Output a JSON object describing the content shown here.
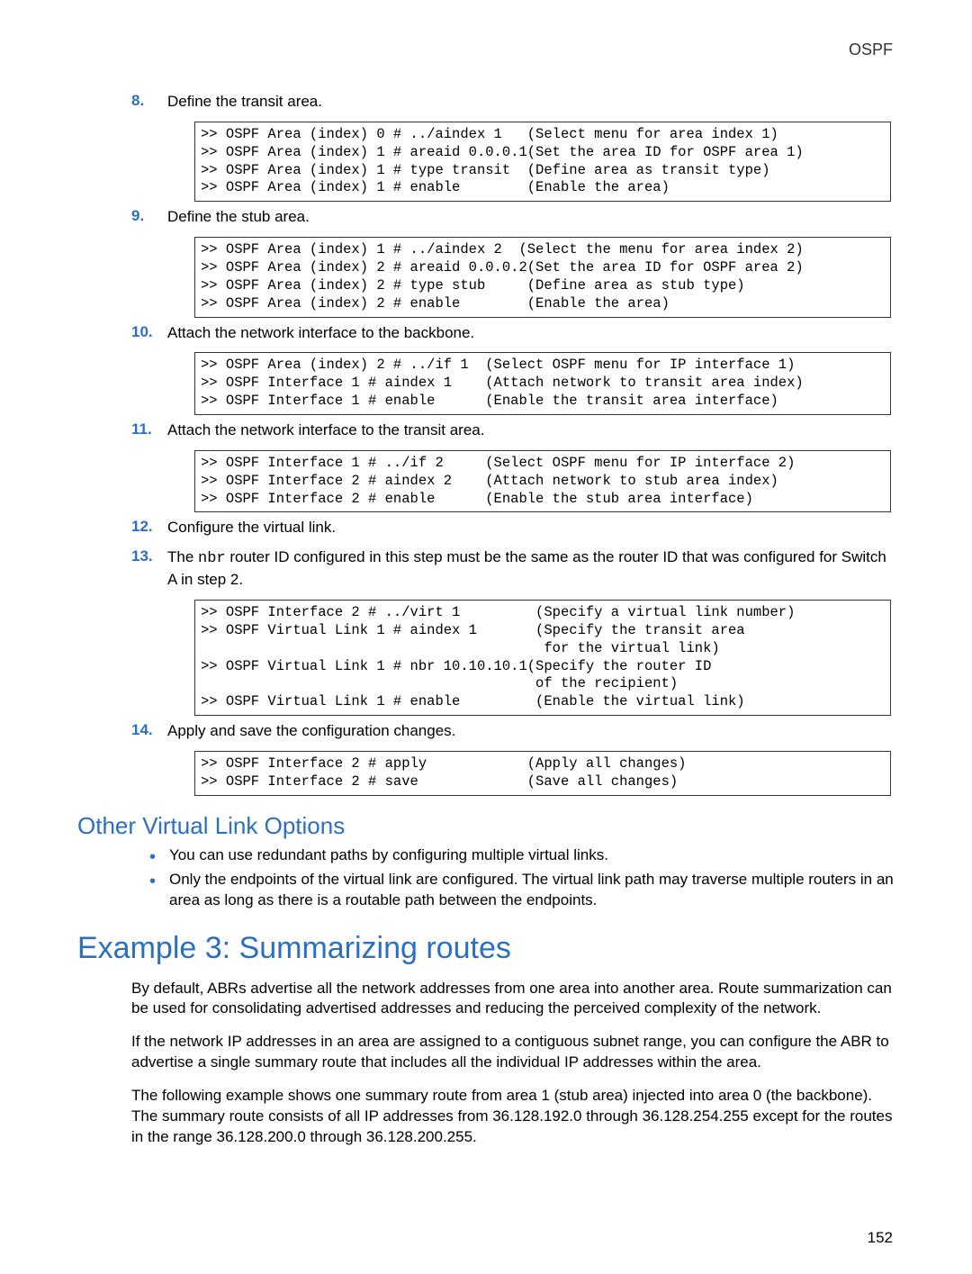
{
  "header": {
    "right": "OSPF"
  },
  "steps": [
    {
      "num": "8.",
      "text": "Define the transit area."
    },
    {
      "num": "9.",
      "text": "Define the stub area."
    },
    {
      "num": "10.",
      "text": "Attach the network interface to the backbone."
    },
    {
      "num": "11.",
      "text": "Attach the network interface to the transit area."
    },
    {
      "num": "12.",
      "text": "Configure the virtual link."
    },
    {
      "num": "13.",
      "text_pre": "The ",
      "mono": "nbr",
      "text_post": " router ID configured in this step must be the same as the router ID that was configured for Switch A in step 2."
    },
    {
      "num": "14.",
      "text": "Apply and save the configuration changes."
    }
  ],
  "code": {
    "box8": ">> OSPF Area (index) 0 # ../aindex 1   (Select menu for area index 1)\n>> OSPF Area (index) 1 # areaid 0.0.0.1(Set the area ID for OSPF area 1)\n>> OSPF Area (index) 1 # type transit  (Define area as transit type)\n>> OSPF Area (index) 1 # enable        (Enable the area)",
    "box9": ">> OSPF Area (index) 1 # ../aindex 2  (Select the menu for area index 2)\n>> OSPF Area (index) 2 # areaid 0.0.0.2(Set the area ID for OSPF area 2)\n>> OSPF Area (index) 2 # type stub     (Define area as stub type)\n>> OSPF Area (index) 2 # enable        (Enable the area)",
    "box10": ">> OSPF Area (index) 2 # ../if 1  (Select OSPF menu for IP interface 1)\n>> OSPF Interface 1 # aindex 1    (Attach network to transit area index)\n>> OSPF Interface 1 # enable      (Enable the transit area interface)",
    "box11": ">> OSPF Interface 1 # ../if 2     (Select OSPF menu for IP interface 2)\n>> OSPF Interface 2 # aindex 2    (Attach network to stub area index)\n>> OSPF Interface 2 # enable      (Enable the stub area interface)",
    "box13": ">> OSPF Interface 2 # ../virt 1         (Specify a virtual link number)\n>> OSPF Virtual Link 1 # aindex 1       (Specify the transit area\n                                         for the virtual link)\n>> OSPF Virtual Link 1 # nbr 10.10.10.1(Specify the router ID\n                                        of the recipient)\n>> OSPF Virtual Link 1 # enable         (Enable the virtual link)",
    "box14": ">> OSPF Interface 2 # apply            (Apply all changes)\n>> OSPF Interface 2 # save             (Save all changes)"
  },
  "subheading": "Other Virtual Link Options",
  "bullets": [
    "You can use redundant paths by configuring multiple virtual links.",
    "Only the endpoints of the virtual link are configured. The virtual link path may traverse multiple routers in an area as long as there is a routable path between the endpoints."
  ],
  "h2": "Example 3: Summarizing routes",
  "paras": [
    "By default, ABRs advertise all the network addresses from one area into another area. Route summarization can be used for consolidating advertised addresses and reducing the perceived complexity of the network.",
    "If the network IP addresses in an area are assigned to a contiguous subnet range, you can configure the ABR to advertise a single summary route that includes all the individual IP addresses within the area.",
    "The following example shows one summary route from area 1 (stub area) injected into area 0 (the backbone). The summary route consists of all IP addresses from 36.128.192.0 through 36.128.254.255 except for the routes in the range 36.128.200.0 through 36.128.200.255."
  ],
  "pagenum": "152"
}
